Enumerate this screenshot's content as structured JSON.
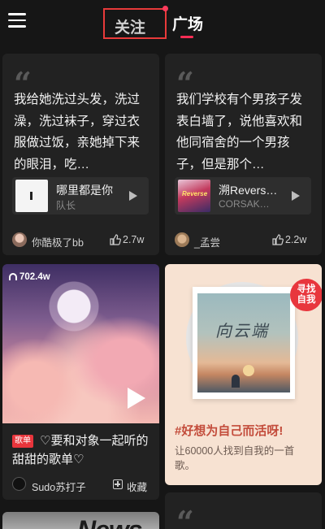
{
  "header": {
    "tabs": [
      {
        "label": "关注",
        "active": false
      },
      {
        "label": "广场",
        "active": true
      }
    ],
    "accent": "#ff2d55"
  },
  "cards": [
    {
      "type": "post",
      "text": "我给她洗过头发，洗过澡，洗过袜子，穿过衣服做过饭，亲她掉下来的眼泪，吃…",
      "song": {
        "title": "哪里都是你",
        "artist": "队长"
      },
      "author": "你酷极了bb",
      "likes": "2.7w"
    },
    {
      "type": "post",
      "text": "我们学校有个男孩子发表白墙了，说他喜欢和他同宿舍的一个男孩子，但是那个…",
      "song": {
        "title": "溯Revers…",
        "artist": "CORSAK…",
        "cover_text": "Reverse"
      },
      "author": "_孟尝",
      "likes": "2.2w"
    },
    {
      "type": "playlist",
      "plays": "702.4w",
      "tag": "歌单",
      "title": "♡要和对象一起听的甜甜的歌单♡",
      "author": "Sudo苏打子",
      "favorite_label": "收藏"
    },
    {
      "type": "topic",
      "badge": "寻找自我",
      "cover_script": "向云端",
      "title": "#好想为自己而活呀!",
      "description": "让60000人找到自我的一首歌。"
    },
    {
      "type": "partial",
      "cover_text": "News"
    },
    {
      "type": "partial-quote"
    }
  ]
}
